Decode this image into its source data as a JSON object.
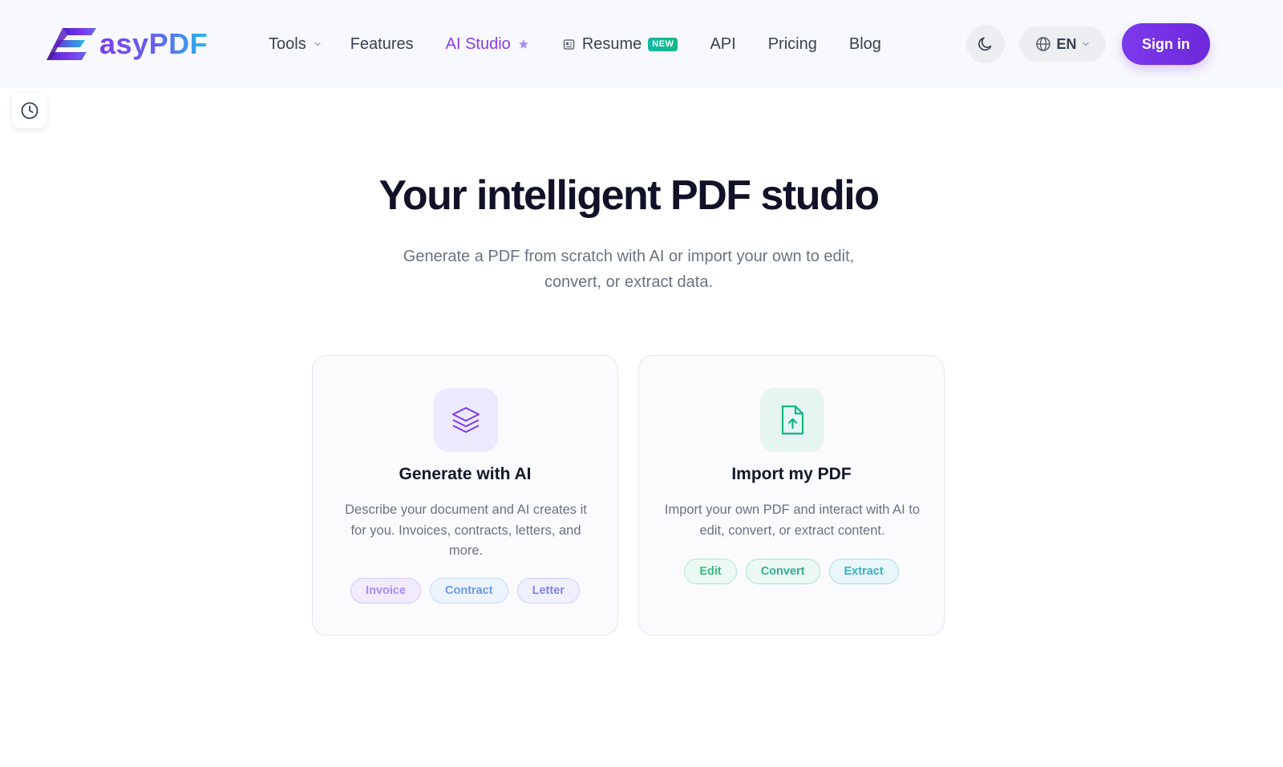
{
  "brand": {
    "logo_letter": "E",
    "logo_rest": "asyPDF"
  },
  "nav": {
    "tools": "Tools",
    "features": "Features",
    "ai_studio": "AI Studio",
    "resume": "Resume",
    "resume_badge": "NEW",
    "api": "API",
    "pricing": "Pricing",
    "blog": "Blog"
  },
  "header_actions": {
    "language": "EN",
    "sign_in": "Sign in"
  },
  "hero": {
    "title": "Your intelligent PDF studio",
    "subtitle": "Generate a PDF from scratch with AI or import your own to edit, convert, or extract data."
  },
  "cards": [
    {
      "title": "Generate with AI",
      "description": "Describe your document and AI creates it for you. Invoices, contracts, letters, and more.",
      "icon": "layers-icon",
      "chips": [
        "Invoice",
        "Contract",
        "Letter"
      ]
    },
    {
      "title": "Import my PDF",
      "description": "Import your own PDF and interact with AI to edit, convert, or extract content.",
      "icon": "file-upload-icon",
      "chips": [
        "Edit",
        "Convert",
        "Extract"
      ]
    }
  ],
  "colors": {
    "accent": "#7c3aed",
    "ai_nav": "#8b3bf0",
    "import_icon": "#10b981"
  }
}
